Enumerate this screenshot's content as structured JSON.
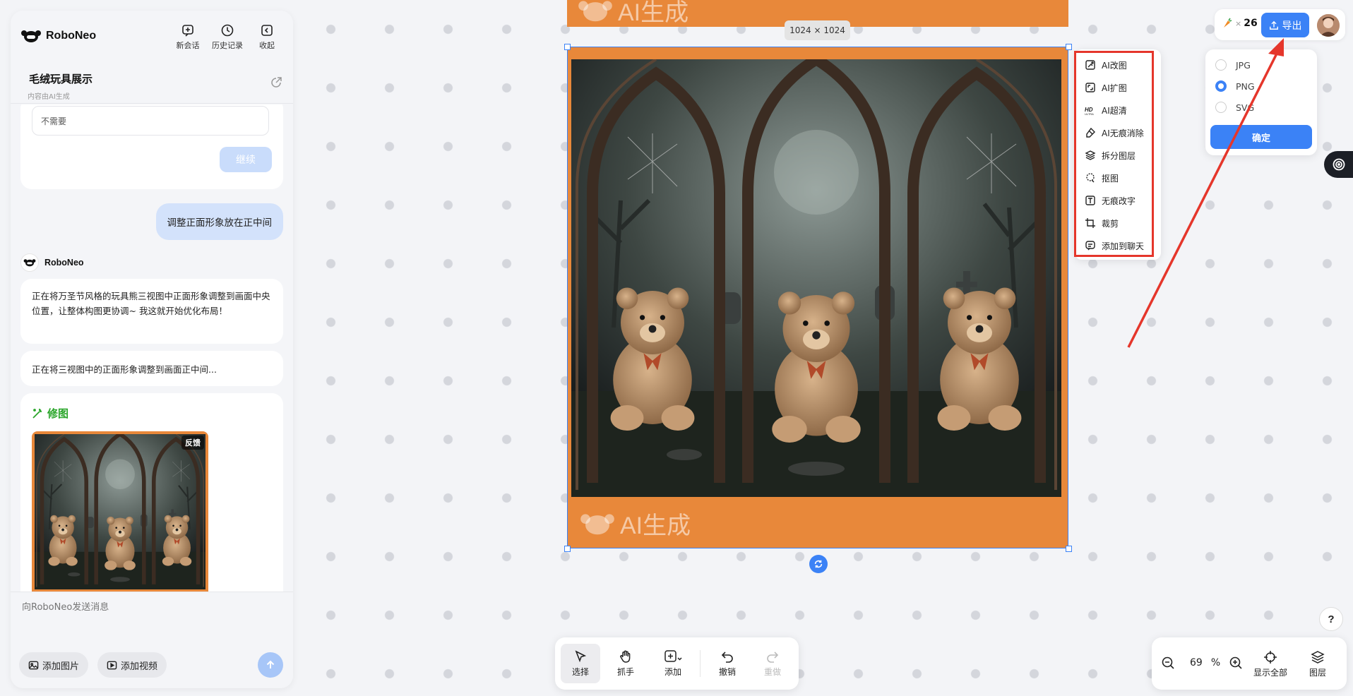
{
  "app": {
    "name": "RoboNeo",
    "actions": [
      {
        "label": "新会话",
        "icon": "new-chat-icon"
      },
      {
        "label": "历史记录",
        "icon": "history-icon"
      },
      {
        "label": "收起",
        "icon": "collapse-icon"
      }
    ],
    "conversation_title": "毛绒玩具展示",
    "conversation_subtitle": "内容由AI生成"
  },
  "chat": {
    "input_value": "不需要",
    "continue_label": "继续",
    "user_message": "调整正面形象放在正中间",
    "bot_name": "RoboNeo",
    "bot_message_1": "正在将万圣节风格的玩具熊三视图中正面形象调整到画面中央位置，让整体构图更协调~ 我这就开始优化布局！",
    "bot_message_2": "正在将三视图中的正面形象调整到画面正中间...",
    "edit_title": "修图",
    "feedback_label": "反馈"
  },
  "composer": {
    "placeholder": "向RoboNeo发送消息",
    "add_image": "添加图片",
    "add_video": "添加视频"
  },
  "canvas": {
    "dimension_label": "1024 × 1024",
    "watermark": "AI生成",
    "frame_color": "#e8883a",
    "selection_color": "#3b82f6"
  },
  "context_menu": [
    {
      "label": "AI改图",
      "icon": "ai-edit-icon"
    },
    {
      "label": "AI扩图",
      "icon": "ai-expand-icon"
    },
    {
      "label": "AI超清",
      "icon": "hd-ultra-icon"
    },
    {
      "label": "AI无痕消除",
      "icon": "eraser-icon"
    },
    {
      "label": "拆分图层",
      "icon": "layers-split-icon"
    },
    {
      "label": "抠图",
      "icon": "cutout-icon"
    },
    {
      "label": "无痕改字",
      "icon": "text-edit-icon"
    },
    {
      "label": "裁剪",
      "icon": "crop-icon"
    },
    {
      "label": "添加到聊天",
      "icon": "add-to-chat-icon"
    }
  ],
  "header_right": {
    "credits": "26",
    "credits_multiplier": "×",
    "export_label": "导出"
  },
  "export_formats": {
    "options": [
      "JPG",
      "PNG",
      "SVG"
    ],
    "selected": "PNG",
    "confirm_label": "确定"
  },
  "toolbar": [
    {
      "label": "选择",
      "icon": "select-cursor-icon",
      "active": true
    },
    {
      "label": "抓手",
      "icon": "hand-icon"
    },
    {
      "label": "添加",
      "icon": "add-icon"
    },
    {
      "label": "撤销",
      "icon": "undo-icon"
    },
    {
      "label": "重做",
      "icon": "redo-icon",
      "disabled": true
    }
  ],
  "zoom": {
    "value": "69",
    "unit": "%",
    "fit_label": "显示全部",
    "layers_label": "图层"
  },
  "help_label": "?",
  "annotation_color": "#e5362b"
}
